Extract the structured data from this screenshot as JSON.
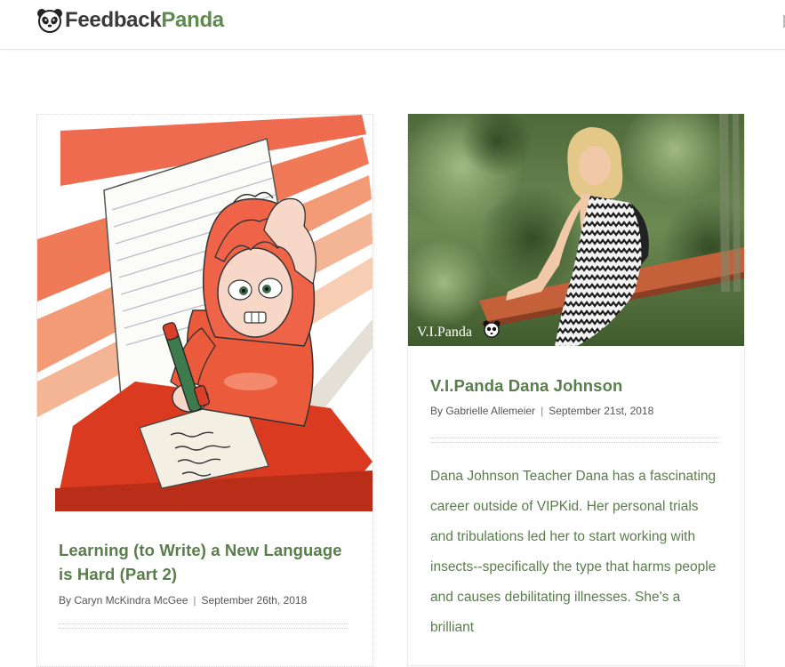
{
  "header": {
    "logo_part1": "Feedback",
    "logo_part2": "Panda"
  },
  "posts": [
    {
      "title": "Learning (to Write) a New Language is Hard (Part 2)",
      "author": "By Caryn McKindra McGee",
      "date": "September 26th, 2018",
      "image": "cartoon-student-writing-illustration"
    },
    {
      "title": "V.I.Panda Dana Johnson",
      "author": "By Gabrielle Allemeier",
      "date": "September 21st, 2018",
      "image": "photo-dana-johnson-leaning-on-railing",
      "watermark": "V.I.Panda",
      "excerpt": "Dana Johnson Teacher Dana has a fascinating career outside of VIPKid. Her personal trials and tribulations led her to start working with insects--specifically the type that harms people and causes debilitating illnesses. She's a brilliant"
    }
  ],
  "colors": {
    "accent": "#5a7d4c",
    "logo_green": "#5f8a4f",
    "coral": "#ef6b4f"
  }
}
